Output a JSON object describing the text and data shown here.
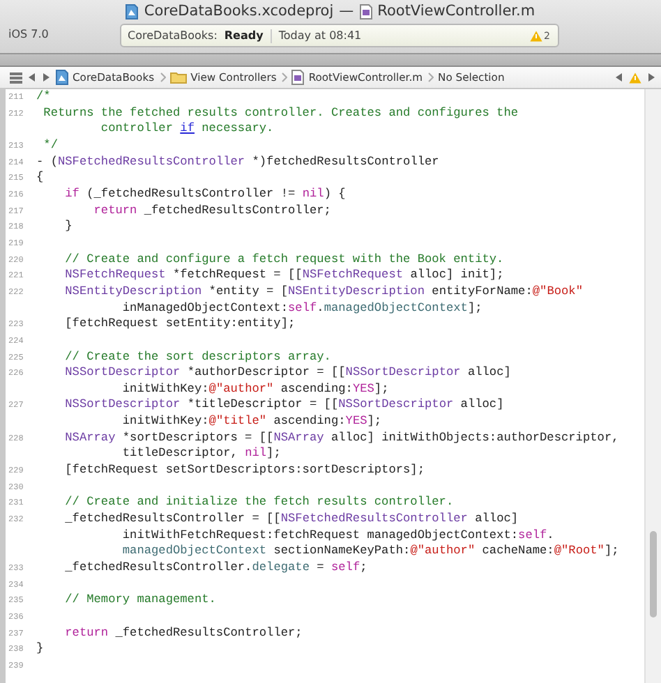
{
  "title_bar": {
    "project": "CoreDataBooks.xcodeproj",
    "separator": "—",
    "file": "RootViewController.m"
  },
  "toolbar": {
    "scheme": "iOS 7.0",
    "activity": {
      "project": "CoreDataBooks:",
      "status": "Ready",
      "time": "Today at 08:41",
      "warning_count": "2"
    }
  },
  "jump_bar": {
    "items": [
      {
        "kind": "project",
        "label": "CoreDataBooks"
      },
      {
        "kind": "folder",
        "label": "View Controllers"
      },
      {
        "kind": "file",
        "label": "RootViewController.m"
      },
      {
        "kind": "plain",
        "label": "No Selection"
      }
    ]
  },
  "editor": {
    "rows": [
      {
        "number": "211",
        "tokens": [
          {
            "kind": "comment",
            "text": "/*"
          }
        ]
      },
      {
        "number": "212",
        "tokens": [
          {
            "kind": "comment",
            "text": " Returns the fetched results controller. Creates and configures the"
          }
        ]
      },
      {
        "tokens": [
          {
            "kind": "comment",
            "text": "         controller "
          },
          {
            "kind": "link",
            "text": "if"
          },
          {
            "kind": "comment",
            "text": " necessary."
          }
        ]
      },
      {
        "number": "213",
        "tokens": [
          {
            "kind": "comment",
            "text": " */"
          }
        ]
      },
      {
        "number": "214",
        "tokens": [
          {
            "kind": "plain",
            "text": "- ("
          },
          {
            "kind": "type",
            "text": "NSFetchedResultsController"
          },
          {
            "kind": "plain",
            "text": " *)fetchedResultsController"
          }
        ]
      },
      {
        "number": "215",
        "tokens": [
          {
            "kind": "plain",
            "text": "{"
          }
        ]
      },
      {
        "number": "216",
        "tokens": [
          {
            "kind": "keyword",
            "text": "    if"
          },
          {
            "kind": "plain",
            "text": " (_fetchedResultsController != "
          },
          {
            "kind": "keyword",
            "text": "nil"
          },
          {
            "kind": "plain",
            "text": ") {"
          }
        ]
      },
      {
        "number": "217",
        "tokens": [
          {
            "kind": "keyword",
            "text": "        return"
          },
          {
            "kind": "plain",
            "text": " _fetchedResultsController;"
          }
        ]
      },
      {
        "number": "218",
        "tokens": [
          {
            "kind": "plain",
            "text": "    }"
          }
        ]
      },
      {
        "number": "219",
        "tokens": []
      },
      {
        "number": "220",
        "tokens": [
          {
            "kind": "comment",
            "text": "    // Create and configure a fetch request with the Book entity."
          }
        ]
      },
      {
        "number": "221",
        "tokens": [
          {
            "kind": "type",
            "text": "    NSFetchRequest"
          },
          {
            "kind": "plain",
            "text": " *fetchRequest = [["
          },
          {
            "kind": "type",
            "text": "NSFetchRequest"
          },
          {
            "kind": "plain",
            "text": " alloc] init];"
          }
        ]
      },
      {
        "number": "222",
        "tokens": [
          {
            "kind": "type",
            "text": "    NSEntityDescription"
          },
          {
            "kind": "plain",
            "text": " *entity = ["
          },
          {
            "kind": "type",
            "text": "NSEntityDescription"
          },
          {
            "kind": "plain",
            "text": " entityForName:"
          },
          {
            "kind": "string",
            "text": "@\"Book\""
          }
        ]
      },
      {
        "tokens": [
          {
            "kind": "plain",
            "text": "            inManagedObjectContext:"
          },
          {
            "kind": "keyword",
            "text": "self"
          },
          {
            "kind": "plain",
            "text": "."
          },
          {
            "kind": "method",
            "text": "managedObjectContext"
          },
          {
            "kind": "plain",
            "text": "];"
          }
        ]
      },
      {
        "number": "223",
        "tokens": [
          {
            "kind": "plain",
            "text": "    [fetchRequest setEntity:entity];"
          }
        ]
      },
      {
        "number": "224",
        "tokens": []
      },
      {
        "number": "225",
        "tokens": [
          {
            "kind": "comment",
            "text": "    // Create the sort descriptors array."
          }
        ]
      },
      {
        "number": "226",
        "tokens": [
          {
            "kind": "type",
            "text": "    NSSortDescriptor"
          },
          {
            "kind": "plain",
            "text": " *authorDescriptor = [["
          },
          {
            "kind": "type",
            "text": "NSSortDescriptor"
          },
          {
            "kind": "plain",
            "text": " alloc]"
          }
        ]
      },
      {
        "tokens": [
          {
            "kind": "plain",
            "text": "            initWithKey:"
          },
          {
            "kind": "string",
            "text": "@\"author\""
          },
          {
            "kind": "plain",
            "text": " ascending:"
          },
          {
            "kind": "keyword",
            "text": "YES"
          },
          {
            "kind": "plain",
            "text": "];"
          }
        ]
      },
      {
        "number": "227",
        "tokens": [
          {
            "kind": "type",
            "text": "    NSSortDescriptor"
          },
          {
            "kind": "plain",
            "text": " *titleDescriptor = [["
          },
          {
            "kind": "type",
            "text": "NSSortDescriptor"
          },
          {
            "kind": "plain",
            "text": " alloc]"
          }
        ]
      },
      {
        "tokens": [
          {
            "kind": "plain",
            "text": "            initWithKey:"
          },
          {
            "kind": "string",
            "text": "@\"title\""
          },
          {
            "kind": "plain",
            "text": " ascending:"
          },
          {
            "kind": "keyword",
            "text": "YES"
          },
          {
            "kind": "plain",
            "text": "];"
          }
        ]
      },
      {
        "number": "228",
        "tokens": [
          {
            "kind": "type",
            "text": "    NSArray"
          },
          {
            "kind": "plain",
            "text": " *sortDescriptors = [["
          },
          {
            "kind": "type",
            "text": "NSArray"
          },
          {
            "kind": "plain",
            "text": " alloc] initWithObjects:authorDescriptor,"
          }
        ]
      },
      {
        "tokens": [
          {
            "kind": "plain",
            "text": "            titleDescriptor, "
          },
          {
            "kind": "keyword",
            "text": "nil"
          },
          {
            "kind": "plain",
            "text": "];"
          }
        ]
      },
      {
        "number": "229",
        "tokens": [
          {
            "kind": "plain",
            "text": "    [fetchRequest setSortDescriptors:sortDescriptors];"
          }
        ]
      },
      {
        "number": "230",
        "tokens": []
      },
      {
        "number": "231",
        "tokens": [
          {
            "kind": "comment",
            "text": "    // Create and initialize the fetch results controller."
          }
        ]
      },
      {
        "number": "232",
        "tokens": [
          {
            "kind": "plain",
            "text": "    _fetchedResultsController = [["
          },
          {
            "kind": "type",
            "text": "NSFetchedResultsController"
          },
          {
            "kind": "plain",
            "text": " alloc]"
          }
        ]
      },
      {
        "tokens": [
          {
            "kind": "plain",
            "text": "            initWithFetchRequest:fetchRequest managedObjectContext:"
          },
          {
            "kind": "keyword",
            "text": "self"
          },
          {
            "kind": "plain",
            "text": "."
          }
        ]
      },
      {
        "tokens": [
          {
            "kind": "method",
            "text": "            managedObjectContext"
          },
          {
            "kind": "plain",
            "text": " sectionNameKeyPath:"
          },
          {
            "kind": "string",
            "text": "@\"author\""
          },
          {
            "kind": "plain",
            "text": " cacheName:"
          },
          {
            "kind": "string",
            "text": "@\"Root\""
          },
          {
            "kind": "plain",
            "text": "];"
          }
        ]
      },
      {
        "number": "233",
        "tokens": [
          {
            "kind": "plain",
            "text": "    _fetchedResultsController."
          },
          {
            "kind": "method",
            "text": "delegate"
          },
          {
            "kind": "plain",
            "text": " = "
          },
          {
            "kind": "keyword",
            "text": "self"
          },
          {
            "kind": "plain",
            "text": ";"
          }
        ]
      },
      {
        "number": "234",
        "tokens": []
      },
      {
        "number": "235",
        "tokens": [
          {
            "kind": "comment",
            "text": "    // Memory management."
          }
        ]
      },
      {
        "number": "236",
        "tokens": []
      },
      {
        "number": "237",
        "tokens": [
          {
            "kind": "keyword",
            "text": "    return"
          },
          {
            "kind": "plain",
            "text": " _fetchedResultsController;"
          }
        ]
      },
      {
        "number": "238",
        "tokens": [
          {
            "kind": "plain",
            "text": "}"
          }
        ]
      },
      {
        "number": "239",
        "tokens": []
      }
    ]
  }
}
